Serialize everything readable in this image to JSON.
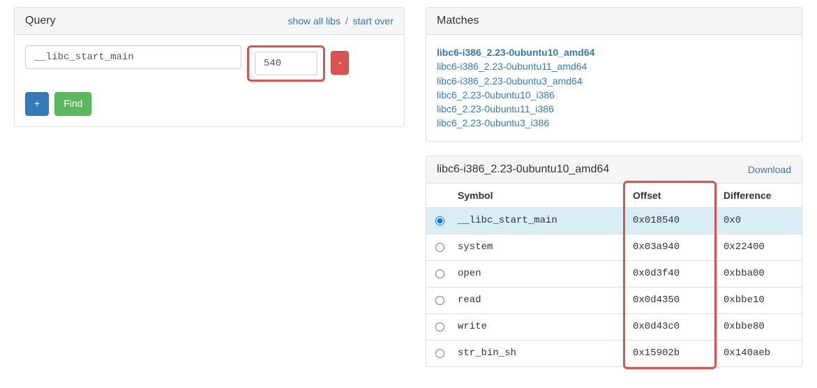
{
  "query": {
    "title": "Query",
    "show_all_libs": "show all libs",
    "start_over": "start over",
    "symbol_value": "__libc_start_main",
    "addr_value": "540",
    "remove_label": "-",
    "add_label": "+",
    "find_label": "Find"
  },
  "matches": {
    "title": "Matches",
    "items": [
      {
        "label": "libc6-i386_2.23-0ubuntu10_amd64",
        "selected": true
      },
      {
        "label": "libc6-i386_2.23-0ubuntu11_amd64",
        "selected": false
      },
      {
        "label": "libc6-i386_2.23-0ubuntu3_amd64",
        "selected": false
      },
      {
        "label": "libc6_2.23-0ubuntu10_i386",
        "selected": false
      },
      {
        "label": "libc6_2.23-0ubuntu11_i386",
        "selected": false
      },
      {
        "label": "libc6_2.23-0ubuntu3_i386",
        "selected": false
      }
    ]
  },
  "symbols": {
    "title": "libc6-i386_2.23-0ubuntu10_amd64",
    "download": "Download",
    "headers": {
      "symbol": "Symbol",
      "offset": "Offset",
      "difference": "Difference"
    },
    "rows": [
      {
        "symbol": "__libc_start_main",
        "offset": "0x018540",
        "difference": "0x0",
        "selected": true
      },
      {
        "symbol": "system",
        "offset": "0x03a940",
        "difference": "0x22400",
        "selected": false
      },
      {
        "symbol": "open",
        "offset": "0x0d3f40",
        "difference": "0xbba00",
        "selected": false
      },
      {
        "symbol": "read",
        "offset": "0x0d4350",
        "difference": "0xbbe10",
        "selected": false
      },
      {
        "symbol": "write",
        "offset": "0x0d43c0",
        "difference": "0xbbe80",
        "selected": false
      },
      {
        "symbol": "str_bin_sh",
        "offset": "0x15902b",
        "difference": "0x140aeb",
        "selected": false
      }
    ]
  },
  "chart_data": {
    "type": "table",
    "title": "libc6-i386_2.23-0ubuntu10_amd64 symbol offsets",
    "columns": [
      "Symbol",
      "Offset",
      "Difference"
    ],
    "rows": [
      [
        "__libc_start_main",
        "0x018540",
        "0x0"
      ],
      [
        "system",
        "0x03a940",
        "0x22400"
      ],
      [
        "open",
        "0x0d3f40",
        "0xbba00"
      ],
      [
        "read",
        "0x0d4350",
        "0xbbe10"
      ],
      [
        "write",
        "0x0d43c0",
        "0xbbe80"
      ],
      [
        "str_bin_sh",
        "0x15902b",
        "0x140aeb"
      ]
    ]
  }
}
